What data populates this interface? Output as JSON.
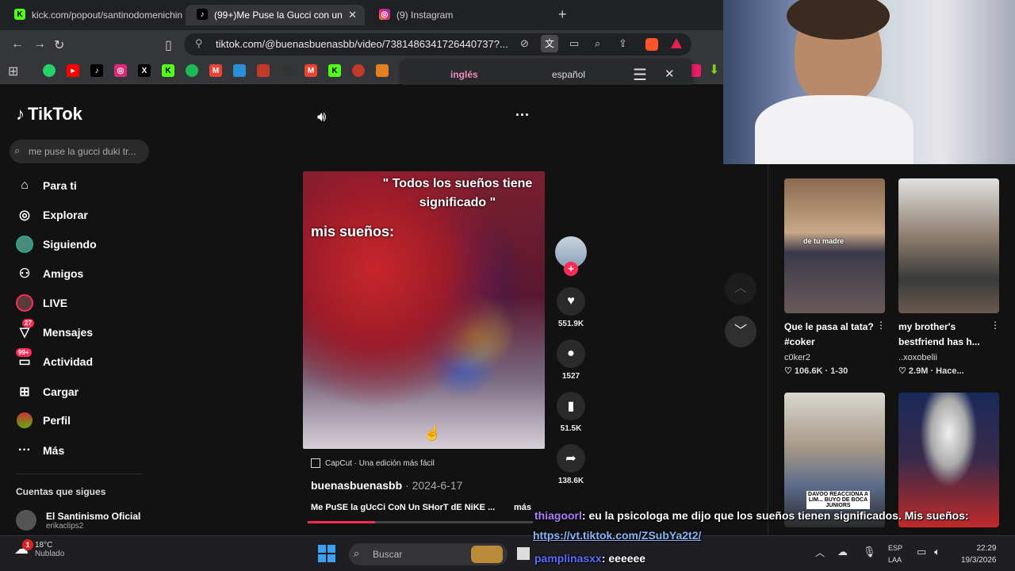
{
  "browser": {
    "tabs": [
      {
        "label": "kick.com/popout/santinodomenichin",
        "icon": "kick-icon",
        "active": false
      },
      {
        "label": "(99+)Me Puse la Gucci con un",
        "icon": "tiktok-icon",
        "active": true
      },
      {
        "label": "(9) Instagram",
        "icon": "instagram-icon",
        "active": false
      }
    ],
    "url": "tiktok.com/@buenasbuenasbb/video/7381486341726440737?...",
    "translate": {
      "lang_active": "inglés",
      "lang_other": "español"
    }
  },
  "tiktok": {
    "logo": "TikTok",
    "search_placeholder": "me puse la gucci duki tr...",
    "nav": [
      {
        "label": "Para ti",
        "icon": "home-icon"
      },
      {
        "label": "Explorar",
        "icon": "compass-icon"
      },
      {
        "label": "Siguiendo",
        "icon": "following-avatar-icon"
      },
      {
        "label": "Amigos",
        "icon": "friends-icon"
      },
      {
        "label": "LIVE",
        "icon": "live-icon"
      },
      {
        "label": "Mensajes",
        "icon": "messages-icon",
        "badge": "27"
      },
      {
        "label": "Actividad",
        "icon": "activity-icon",
        "badge": "99+"
      },
      {
        "label": "Cargar",
        "icon": "upload-icon"
      },
      {
        "label": "Perfil",
        "icon": "profile-icon"
      },
      {
        "label": "Más",
        "icon": "more-icon"
      }
    ],
    "following_header": "Cuentas que sigues",
    "following": [
      {
        "name": "El Santinismo Oficial",
        "handle": "erikaclips2"
      }
    ],
    "video": {
      "caption_top": "\" Todos los sueños tiene significado \"",
      "caption_mid": "mis sueños:",
      "capcut": "CapCut · Una edición más fácil",
      "author": "buenasbuenasbb",
      "date": "2024-6-17",
      "desc": "Me PuSE la gUcCi CoN Un SHorT dE NiKE ...",
      "more": "más",
      "progress": 0.3
    },
    "actions": {
      "likes": "551.9K",
      "comments": "1527",
      "saves": "51.5K",
      "shares": "138.6K"
    },
    "related": [
      {
        "title": "Que le pasa al tata? #coker",
        "author": "c0ker2",
        "likes": "106.6K",
        "date": "1-30",
        "thumb_text": "de tu madre"
      },
      {
        "title": "my brother's bestfriend has h...",
        "author": "..xoxobelii",
        "likes": "2.9M",
        "date": "Hace...",
        "thumb_text": ""
      },
      {
        "title": "",
        "author": "",
        "likes": "",
        "date": "",
        "thumb_text": "DAVOO REACCIONA A LIM... BUYO DE BOCA JUNIORS"
      },
      {
        "title": "",
        "author": "",
        "likes": "",
        "date": "",
        "thumb_text": ""
      }
    ]
  },
  "chat": [
    {
      "user": "thiagoorl",
      "user_color": "#b07cff",
      "text": ": eu la psicologa me dijo que los sueños tienen significados. Mis sueños:"
    },
    {
      "user": "",
      "user_color": "#ffffff",
      "text": "https://vt.tiktok.com/ZSubYa2t2/"
    },
    {
      "user": "pamplinasxx",
      "user_color": "#5b6cff",
      "text": ": eeeeee"
    }
  ],
  "taskbar": {
    "weather_temp": "18°C",
    "weather_desc": "Nublado",
    "weather_badge": "1",
    "search": "Buscar",
    "lang1": "ESP",
    "lang2": "LAA",
    "time": "22:29",
    "date": "19/3/2026"
  },
  "colors": {
    "accent": "#fe2c55",
    "kick": "#53fc18",
    "bg": "#121212"
  }
}
